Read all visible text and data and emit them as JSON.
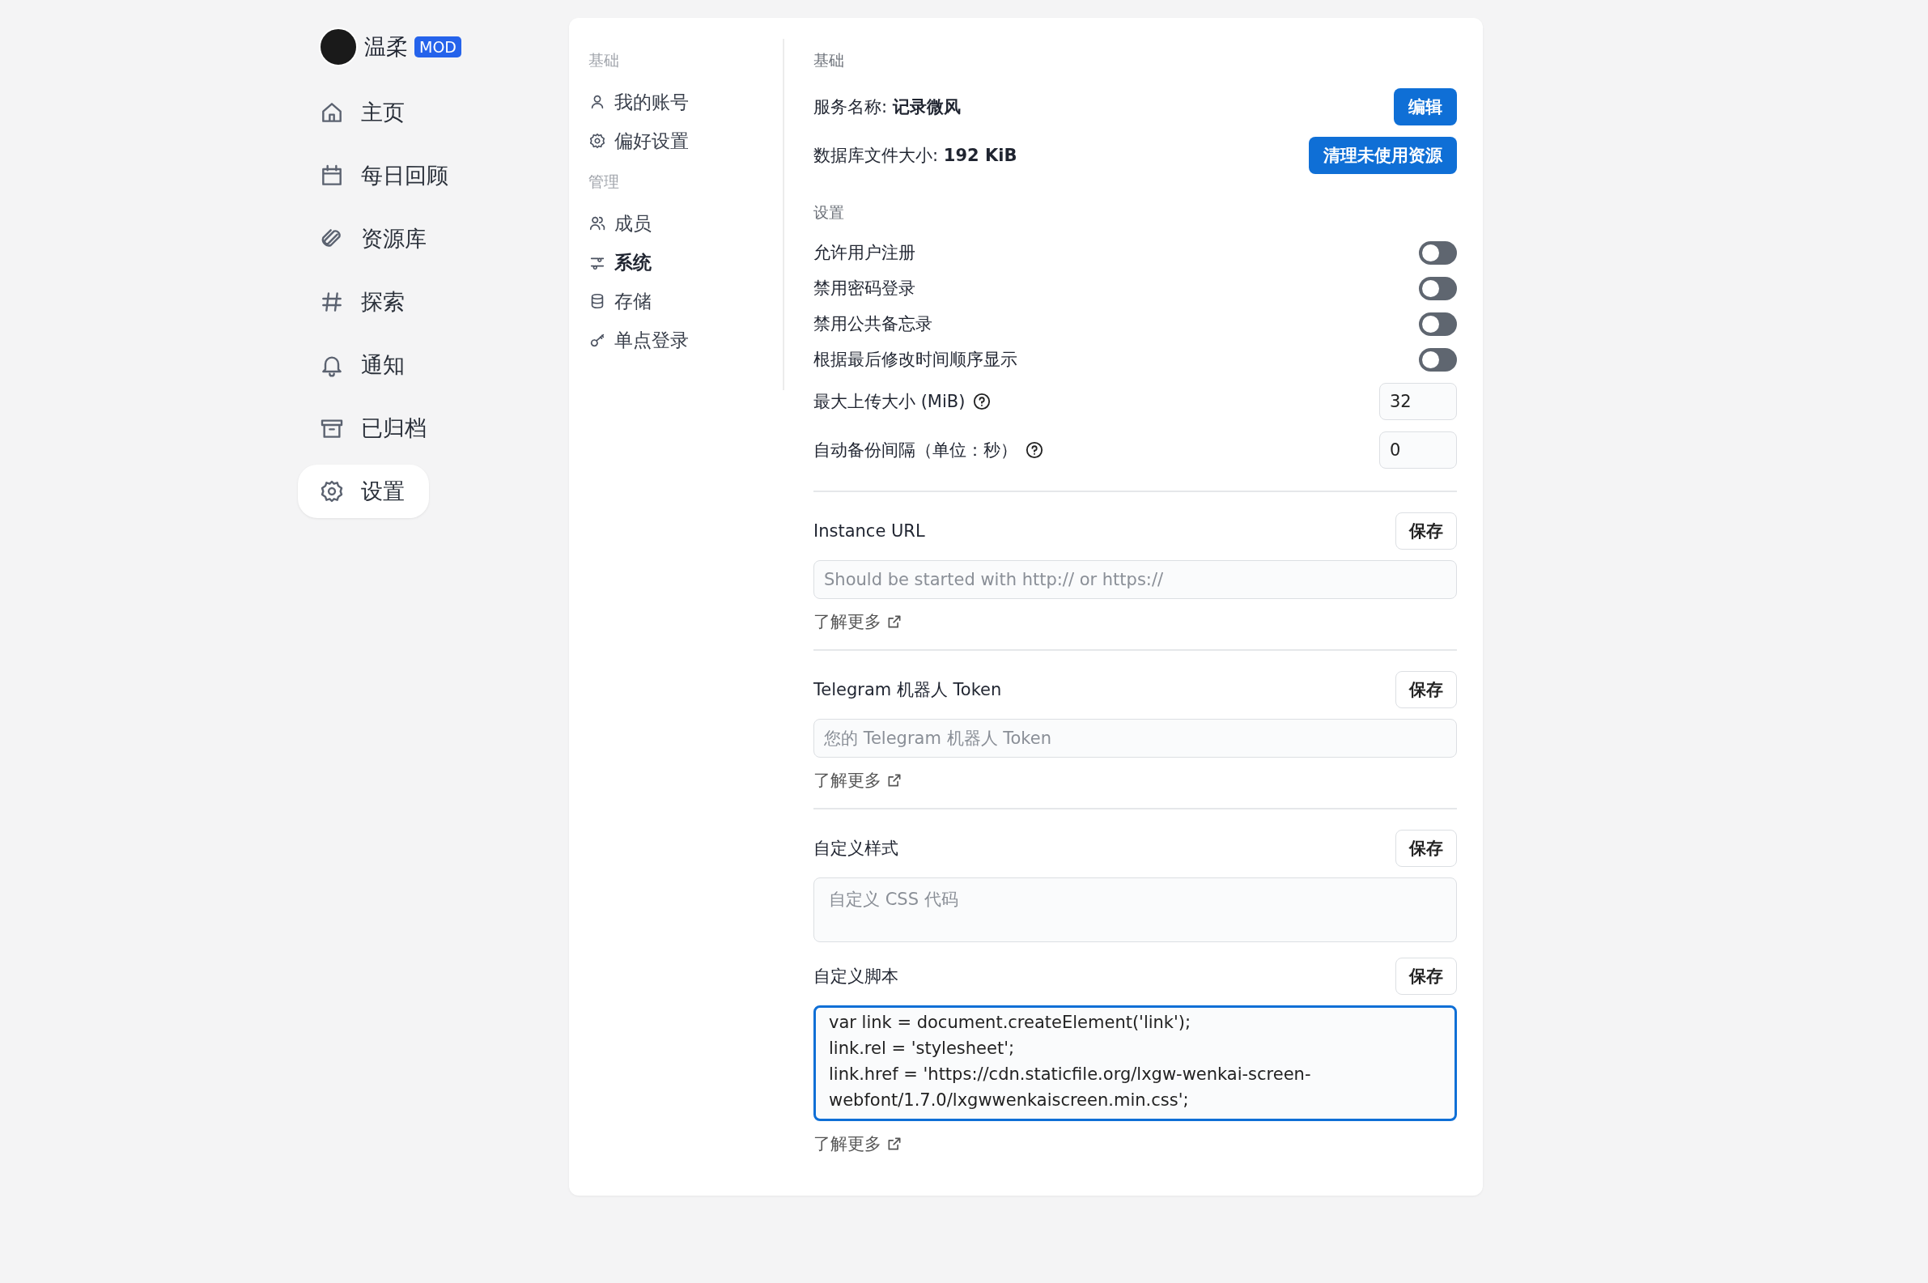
{
  "sidebar": {
    "user": {
      "name": "温柔",
      "badge": "MOD"
    },
    "items": [
      {
        "label": "主页",
        "kind": "home",
        "selected": false
      },
      {
        "label": "每日回顾",
        "kind": "calendar",
        "selected": false
      },
      {
        "label": "资源库",
        "kind": "paperclip",
        "selected": false
      },
      {
        "label": "探索",
        "kind": "hash",
        "selected": false
      },
      {
        "label": "通知",
        "kind": "bell",
        "selected": false
      },
      {
        "label": "已归档",
        "kind": "archive",
        "selected": false
      },
      {
        "label": "设置",
        "kind": "gear",
        "selected": true
      }
    ]
  },
  "settings_nav": {
    "groups": [
      {
        "title": "基础",
        "items": [
          {
            "label": "我的账号",
            "kind": "user",
            "selected": false
          },
          {
            "label": "偏好设置",
            "kind": "gear",
            "selected": false
          }
        ]
      },
      {
        "title": "管理",
        "items": [
          {
            "label": "成员",
            "kind": "users",
            "selected": false
          },
          {
            "label": "系统",
            "kind": "sliders",
            "selected": true
          },
          {
            "label": "存储",
            "kind": "database",
            "selected": false
          },
          {
            "label": "单点登录",
            "kind": "key",
            "selected": false
          }
        ]
      }
    ]
  },
  "main": {
    "section_title": "基础",
    "info": [
      {
        "text": "服务名称: **记录微风**",
        "button": "编辑"
      },
      {
        "text": "数据库文件大小: **192 KiB**",
        "button": "清理未使用资源"
      }
    ],
    "settings_title": "设置",
    "toggles": [
      {
        "label": "允许用户注册",
        "on": false
      },
      {
        "label": "禁用密码登录",
        "on": false
      },
      {
        "label": "禁用公共备忘录",
        "on": false
      },
      {
        "label": "根据最后修改时间顺序显示",
        "on": false
      }
    ],
    "number_fields": [
      {
        "label": "最大上传大小 (MiB)",
        "value": "32"
      },
      {
        "label": "自动备份间隔（单位：秒）",
        "value": "0"
      }
    ],
    "blocks": [
      {
        "kind": "input",
        "label": "Instance URL",
        "button": "保存",
        "placeholder": "Should be started with http:// or https://",
        "link": "了解更多"
      },
      {
        "kind": "input",
        "label": "Telegram 机器人 Token",
        "button": "保存",
        "placeholder": "您的 Telegram 机器人 Token",
        "link": "了解更多"
      },
      {
        "kind": "textarea",
        "label": "自定义样式",
        "button": "保存",
        "placeholder": "自定义 CSS 代码",
        "focused": false
      },
      {
        "kind": "textarea",
        "label": "自定义脚本",
        "button": "保存",
        "value": "var link = document.createElement('link');\nlink.rel = 'stylesheet';\nlink.href = 'https://cdn.staticfile.org/lxgw-wenkai-screen-webfont/1.7.0/lxgwwenkaiscreen.min.css';",
        "focused": true,
        "link": "了解更多"
      }
    ]
  }
}
